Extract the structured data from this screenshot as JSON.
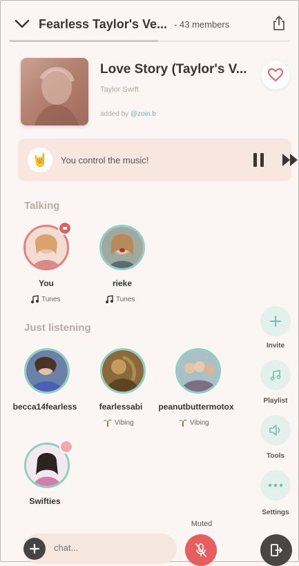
{
  "header": {
    "room_title": "Fearless Taylor's Ve...",
    "member_count": "- 43 members",
    "progress_fraction": 0.53
  },
  "now_playing": {
    "title": "Love Story (Taylor's V...",
    "artist": "Taylor Swift",
    "added_prefix": "added by ",
    "added_user": "@zoin.b"
  },
  "control_bar": {
    "message": "You control the music!"
  },
  "sections": {
    "talking": "Talking",
    "listening": "Just listening"
  },
  "talking": [
    {
      "name": "You",
      "status": "Tunes",
      "status_icon": "music-note-icon",
      "speaking": true
    },
    {
      "name": "rieke",
      "status": "Tunes",
      "status_icon": "music-note-icon",
      "speaking": false
    }
  ],
  "listening": [
    {
      "name": "becca14fearless",
      "status": ""
    },
    {
      "name": "fearlessabi",
      "status": "Vibing",
      "status_icon": "palm-tree-icon"
    },
    {
      "name": "peanutbuttermotox",
      "status": "Vibing",
      "status_icon": "palm-tree-icon"
    },
    {
      "name": "Swifties",
      "status": ""
    }
  ],
  "side_actions": [
    {
      "label": "Invite",
      "icon": "plus-icon"
    },
    {
      "label": "Playlist",
      "icon": "music-note-icon"
    },
    {
      "label": "Tools",
      "icon": "speaker-icon"
    },
    {
      "label": "Settings",
      "icon": "more-dots-icon"
    }
  ],
  "bottom": {
    "chat_placeholder": "chat...",
    "muted_label": "Muted"
  },
  "colors": {
    "background": "#fbf6f3",
    "accent_red": "#e85d5d",
    "accent_teal": "#8fcfc2",
    "control_bar": "#f7e7df"
  }
}
